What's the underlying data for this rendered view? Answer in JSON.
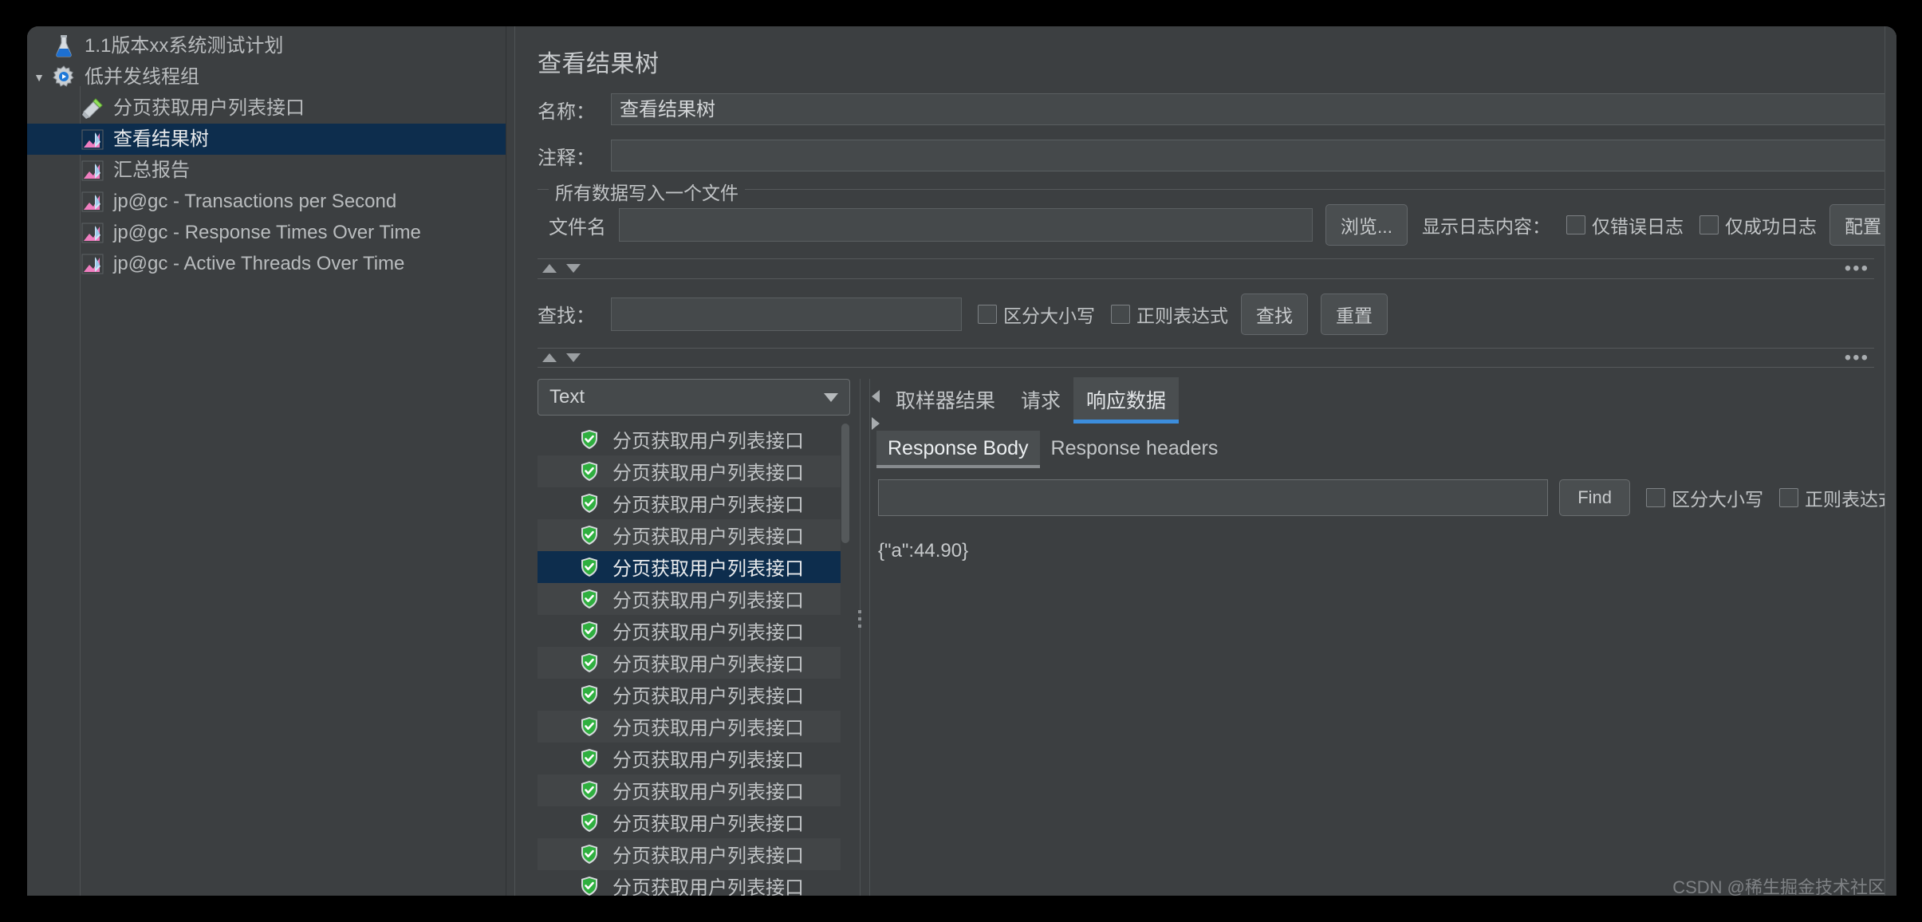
{
  "tree": {
    "items": [
      {
        "label": "1.1版本xx系统测试计划",
        "icon": "flask-icon",
        "depth": 0,
        "twisty": "",
        "selected": false
      },
      {
        "label": "低并发线程组",
        "icon": "gear-icon",
        "depth": 0,
        "twisty": "▼",
        "selected": false
      },
      {
        "label": "分页获取用户列表接口",
        "icon": "pipette-icon",
        "depth": 1,
        "twisty": "",
        "selected": false
      },
      {
        "label": "查看结果树",
        "icon": "listener-icon",
        "depth": 1,
        "twisty": "",
        "selected": true
      },
      {
        "label": "汇总报告",
        "icon": "listener-icon",
        "depth": 1,
        "twisty": "",
        "selected": false
      },
      {
        "label": "jp@gc - Transactions per Second",
        "icon": "listener-icon",
        "depth": 1,
        "twisty": "",
        "selected": false
      },
      {
        "label": "jp@gc - Response Times Over Time",
        "icon": "listener-icon",
        "depth": 1,
        "twisty": "",
        "selected": false
      },
      {
        "label": "jp@gc - Active Threads Over Time",
        "icon": "listener-icon",
        "depth": 1,
        "twisty": "",
        "selected": false
      }
    ]
  },
  "panel": {
    "title": "查看结果树",
    "name_label": "名称：",
    "name_value": "查看结果树",
    "comment_label": "注释：",
    "comment_value": "",
    "filegroup": {
      "legend": "所有数据写入一个文件",
      "filename_label": "文件名",
      "filename_value": "",
      "browse_button": "浏览...",
      "log_content_label": "显示日志内容：",
      "errors_only_label": "仅错误日志",
      "errors_only_checked": false,
      "success_only_label": "仅成功日志",
      "success_only_checked": false,
      "configure_button": "配置"
    },
    "search": {
      "label": "查找：",
      "value": "",
      "case_label": "区分大小写",
      "case_checked": false,
      "regex_label": "正则表达式",
      "regex_checked": false,
      "find_button": "查找",
      "reset_button": "重置"
    },
    "renderer": {
      "selected": "Text"
    },
    "results": {
      "rows": [
        {
          "label": "分页获取用户列表接口",
          "status": "success",
          "selected": false
        },
        {
          "label": "分页获取用户列表接口",
          "status": "success",
          "selected": false
        },
        {
          "label": "分页获取用户列表接口",
          "status": "success",
          "selected": false
        },
        {
          "label": "分页获取用户列表接口",
          "status": "success",
          "selected": false
        },
        {
          "label": "分页获取用户列表接口",
          "status": "success",
          "selected": true
        },
        {
          "label": "分页获取用户列表接口",
          "status": "success",
          "selected": false
        },
        {
          "label": "分页获取用户列表接口",
          "status": "success",
          "selected": false
        },
        {
          "label": "分页获取用户列表接口",
          "status": "success",
          "selected": false
        },
        {
          "label": "分页获取用户列表接口",
          "status": "success",
          "selected": false
        },
        {
          "label": "分页获取用户列表接口",
          "status": "success",
          "selected": false
        },
        {
          "label": "分页获取用户列表接口",
          "status": "success",
          "selected": false
        },
        {
          "label": "分页获取用户列表接口",
          "status": "success",
          "selected": false
        },
        {
          "label": "分页获取用户列表接口",
          "status": "success",
          "selected": false
        },
        {
          "label": "分页获取用户列表接口",
          "status": "success",
          "selected": false
        },
        {
          "label": "分页获取用户列表接口",
          "status": "success",
          "selected": false
        }
      ]
    },
    "detail": {
      "tabs": [
        {
          "label": "取样器结果",
          "active": false
        },
        {
          "label": "请求",
          "active": false
        },
        {
          "label": "响应数据",
          "active": true
        }
      ],
      "subtabs": [
        {
          "label": "Response Body",
          "active": true
        },
        {
          "label": "Response headers",
          "active": false
        }
      ],
      "find": {
        "value": "",
        "button": "Find",
        "case_label": "区分大小写",
        "case_checked": false,
        "regex_label": "正则表达式",
        "regex_checked": false
      },
      "body_text": "{\"a\":44.90}"
    }
  },
  "watermark": "CSDN @稀生掘金技术社区",
  "colors": {
    "accent_blue": "#3c8ddc",
    "selection_blue": "#0d2d4d",
    "panel_bg": "#3c3f41",
    "input_bg": "#45494b",
    "success_green": "#2faf3f"
  }
}
